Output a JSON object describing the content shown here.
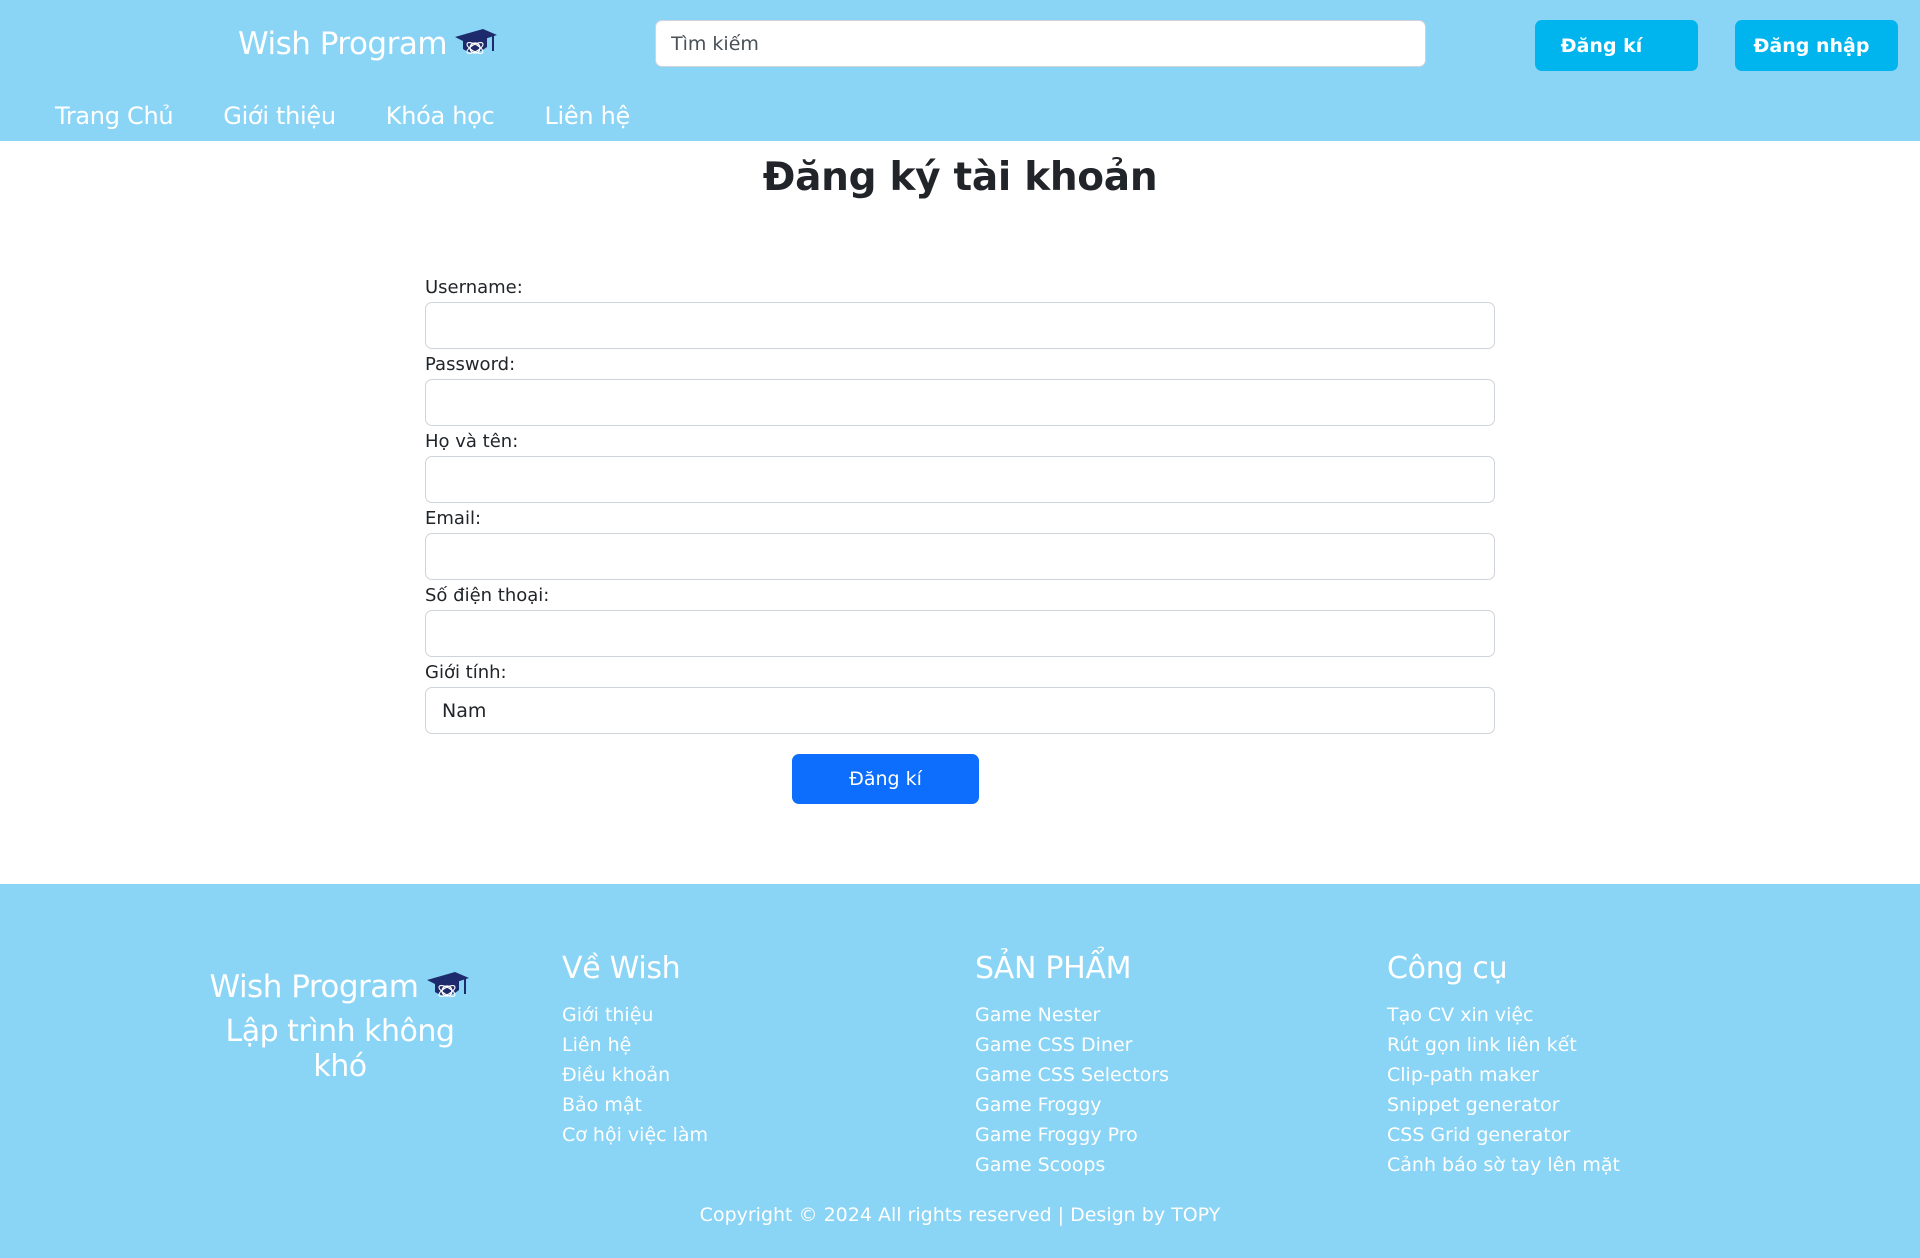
{
  "header": {
    "logo_text": "Wish Program",
    "search": {
      "placeholder": "Tìm kiếm",
      "value": ""
    },
    "register_label": "Đăng kí",
    "login_label": "Đăng nhập",
    "nav": [
      "Trang Chủ",
      "Giới thiệu",
      "Khóa học",
      "Liên hệ"
    ]
  },
  "main": {
    "title": "Đăng ký tài khoản",
    "fields": {
      "username": "Username:",
      "password": "Password:",
      "fullname": "Họ và tên:",
      "email": "Email:",
      "phone": "Số điện thoại:",
      "gender": "Giới tính:"
    },
    "gender_value": "Nam",
    "submit_label": "Đăng kí"
  },
  "footer": {
    "logo_text": "Wish Program",
    "tagline": "Lập trình không khó",
    "columns": [
      {
        "title": "Về Wish",
        "links": [
          "Giới thiệu",
          "Liên hệ",
          "Điều khoản",
          "Bảo mật",
          "Cơ hội việc làm"
        ]
      },
      {
        "title": "SẢN PHẨM",
        "links": [
          "Game Nester",
          "Game CSS Diner",
          "Game CSS Selectors",
          "Game Froggy",
          "Game Froggy Pro",
          "Game Scoops"
        ]
      },
      {
        "title": "Công cụ",
        "links": [
          "Tạo CV xin việc",
          "Rút gọn link liên kết",
          "Clip-path maker",
          "Snippet generator",
          "CSS Grid generator",
          "Cảnh báo sờ tay lên mặt"
        ]
      }
    ],
    "copyright": "Copyright © 2024 All rights reserved | Design by TOPY"
  },
  "colors": {
    "header_bg": "#8ad4f5",
    "header_button": "#00b4ee",
    "primary_button": "#0d6efd",
    "icon_cap": "#1d2a6b"
  },
  "icons": [
    "graduation-cap-icon"
  ]
}
